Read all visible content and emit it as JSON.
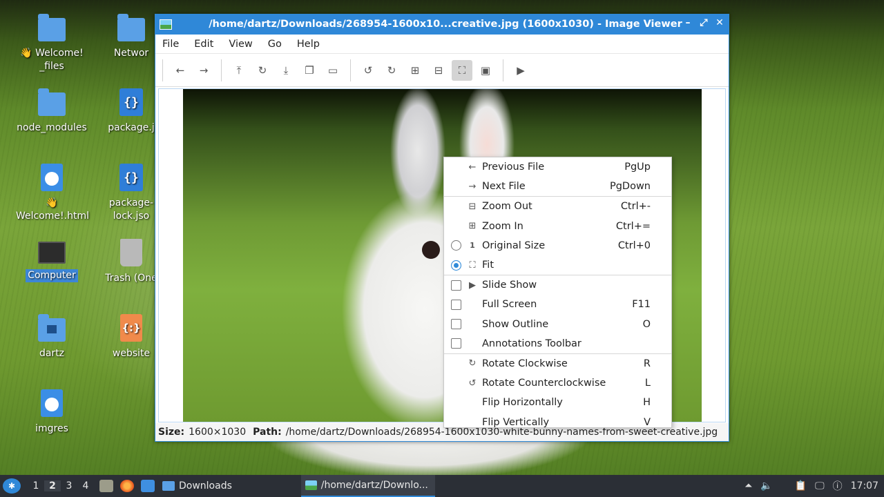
{
  "desktop": {
    "icons": [
      {
        "label": "👋 Welcome!\n_files",
        "kind": "folder"
      },
      {
        "label": "Networ",
        "kind": "folder"
      },
      {
        "label": "node_modules",
        "kind": "folder"
      },
      {
        "label": "package.j",
        "kind": "code-file"
      },
      {
        "label": "👋\nWelcome!.html",
        "kind": "web-file"
      },
      {
        "label": "package-\nlock.jso",
        "kind": "code-file"
      },
      {
        "label": "Computer",
        "kind": "computer"
      },
      {
        "label": "Trash (One",
        "kind": "trash"
      },
      {
        "label": "dartz",
        "kind": "home-folder"
      },
      {
        "label": "website",
        "kind": "js-file"
      },
      {
        "label": "imgres",
        "kind": "web-file"
      }
    ]
  },
  "window": {
    "title": "/home/dartz/Downloads/268954-1600x10...creative.jpg (1600x1030) - Image Viewer",
    "controls": {
      "minimize": "–",
      "maximize": "⤢",
      "close": "✕"
    },
    "menu": [
      "File",
      "Edit",
      "View",
      "Go",
      "Help"
    ],
    "status": {
      "size_label": "Size:",
      "size_value": "1600×1030",
      "path_label": "Path:",
      "path_value": "/home/dartz/Downloads/268954-1600x1030-white-bunny-names-from-sweet-creative.jpg"
    }
  },
  "context_menu": {
    "items": [
      {
        "label": "Previous File",
        "accel": "PgUp",
        "icon": "←"
      },
      {
        "label": "Next File",
        "accel": "PgDown",
        "icon": "→"
      },
      {
        "label": "Zoom Out",
        "accel": "Ctrl+-",
        "icon": "⊟"
      },
      {
        "label": "Zoom In",
        "accel": "Ctrl+=",
        "icon": "⊞"
      },
      {
        "label": "Original Size",
        "accel": "Ctrl+0",
        "icon": "1"
      },
      {
        "label": "Fit",
        "accel": "",
        "icon": "⛶"
      },
      {
        "label": "Slide Show",
        "accel": "",
        "icon": "▶"
      },
      {
        "label": "Full Screen",
        "accel": "F11",
        "icon": ""
      },
      {
        "label": "Show Outline",
        "accel": "O",
        "icon": ""
      },
      {
        "label": "Annotations Toolbar",
        "accel": "",
        "icon": ""
      },
      {
        "label": "Rotate Clockwise",
        "accel": "R",
        "icon": "↻"
      },
      {
        "label": "Rotate Counterclockwise",
        "accel": "L",
        "icon": "↺"
      },
      {
        "label": "Flip Horizontally",
        "accel": "H",
        "icon": ""
      },
      {
        "label": "Flip Vertically",
        "accel": "V",
        "icon": ""
      }
    ]
  },
  "taskbar": {
    "workspaces": [
      "1",
      "2",
      "3",
      "4"
    ],
    "tasks": [
      "Downloads",
      "/home/dartz/Downlo..."
    ],
    "clock": "17:07"
  }
}
